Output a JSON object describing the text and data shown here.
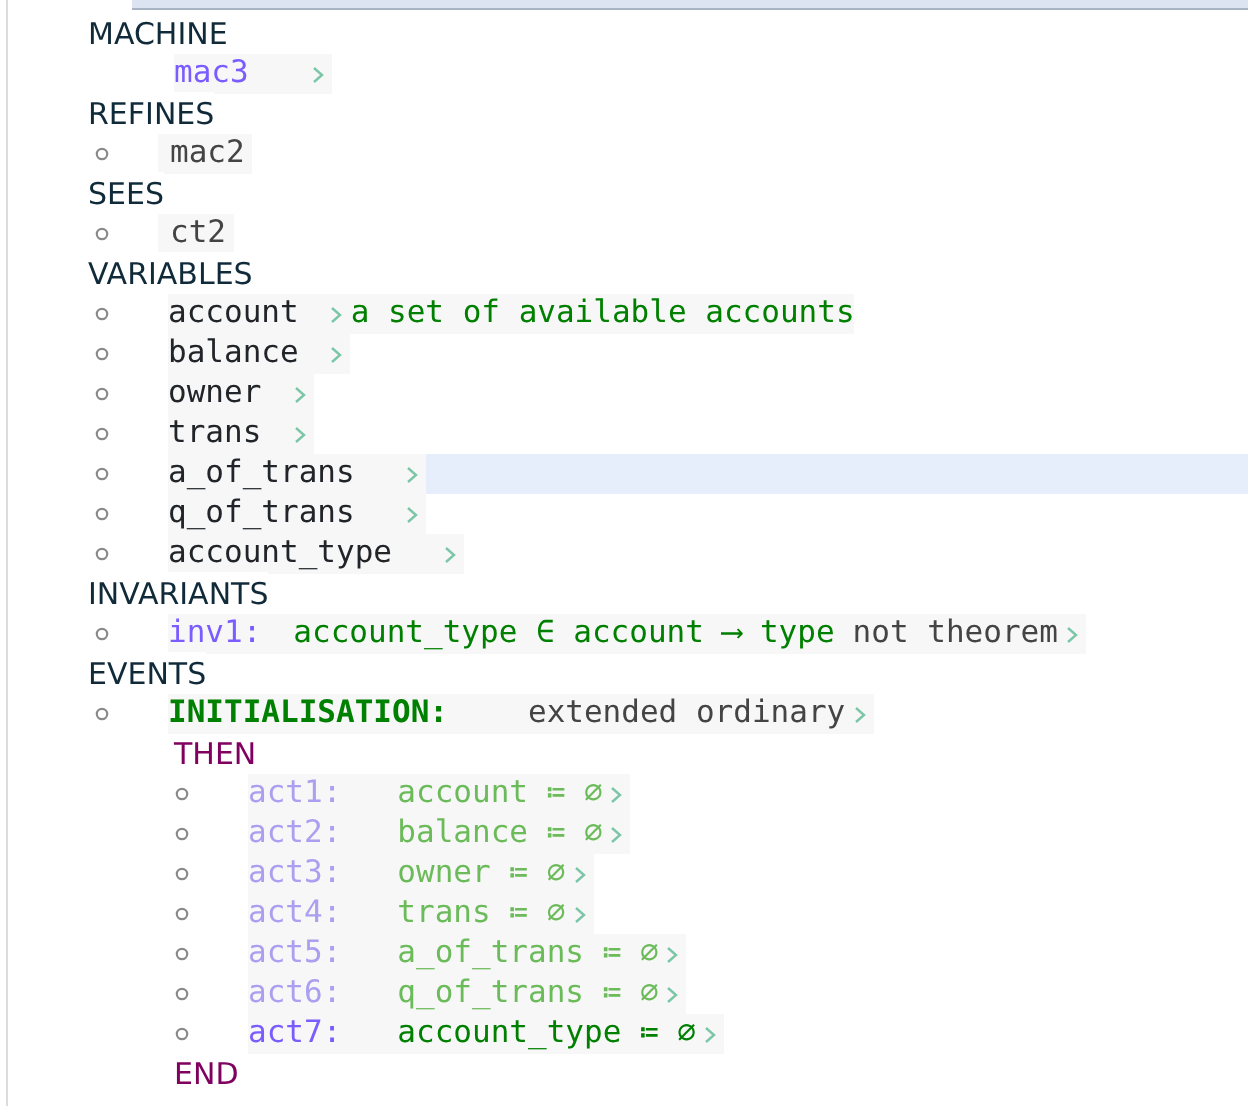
{
  "machine": {
    "keyword": "MACHINE",
    "name": "mac3"
  },
  "refines": {
    "keyword": "REFINES",
    "items": [
      "mac2"
    ]
  },
  "sees": {
    "keyword": "SEES",
    "items": [
      "ct2"
    ]
  },
  "variables": {
    "keyword": "VARIABLES",
    "items": [
      {
        "name": "account",
        "comment": "a set of available accounts",
        "selected": false
      },
      {
        "name": "balance",
        "selected": false
      },
      {
        "name": "owner",
        "selected": false
      },
      {
        "name": "trans",
        "selected": false
      },
      {
        "name": "a_of_trans",
        "selected": true
      },
      {
        "name": "q_of_trans",
        "selected": false
      },
      {
        "name": "account_type",
        "selected": false
      }
    ]
  },
  "invariants": {
    "keyword": "INVARIANTS",
    "items": [
      {
        "label": "inv1:",
        "predicate": "account_type ∈ account ⟶ type",
        "theorem": "not theorem"
      }
    ]
  },
  "events": {
    "keyword": "EVENTS",
    "items": [
      {
        "name": "INITIALISATION:",
        "attributes": "extended ordinary",
        "then": "THEN",
        "end": "END",
        "actions": [
          {
            "label": "act1:",
            "assignment": "account ≔ ∅",
            "inherited": true
          },
          {
            "label": "act2:",
            "assignment": "balance ≔ ∅",
            "inherited": true
          },
          {
            "label": "act3:",
            "assignment": "owner ≔ ∅",
            "inherited": true
          },
          {
            "label": "act4:",
            "assignment": "trans ≔ ∅",
            "inherited": true
          },
          {
            "label": "act5:",
            "assignment": "a_of_trans ≔ ∅",
            "inherited": true
          },
          {
            "label": "act6:",
            "assignment": "q_of_trans ≔ ∅",
            "inherited": true
          },
          {
            "label": "act7:",
            "assignment": "account_type ≔ ∅",
            "inherited": false
          }
        ]
      }
    ]
  }
}
